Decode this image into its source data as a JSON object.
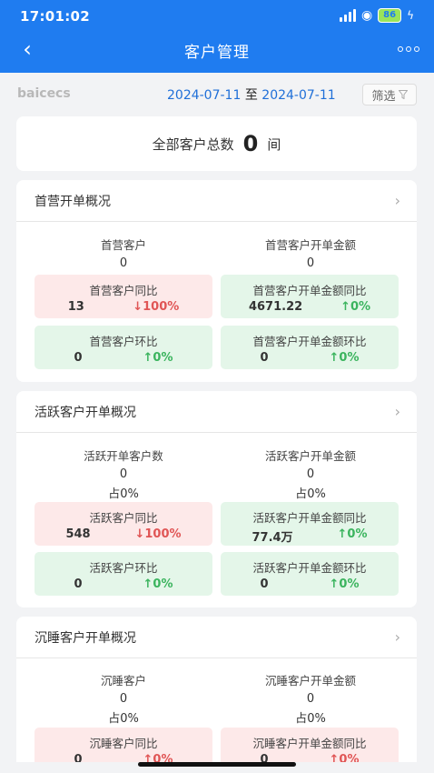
{
  "status_bar": {
    "time": "17:01:02",
    "battery": "86"
  },
  "nav": {
    "title": "客户管理"
  },
  "filter": {
    "brand": "baicecs",
    "start_date": "2024-07-11",
    "separator": "至",
    "end_date": "2024-07-11",
    "filter_label": "筛选"
  },
  "summary": {
    "label": "全部客户总数",
    "count": "0",
    "unit": "间"
  },
  "sections": [
    {
      "title": "首营开单概况",
      "left": {
        "label": "首营客户",
        "value": "0"
      },
      "right": {
        "label": "首营客户开单金额",
        "value": "0"
      },
      "boxes": [
        {
          "label": "首营客户同比",
          "value": "13",
          "change": "↓100%",
          "trend": "down"
        },
        {
          "label": "首营客户开单金额同比",
          "value": "4671.22",
          "change": "↑0%",
          "trend": "up"
        },
        {
          "label": "首营客户环比",
          "value": "0",
          "change": "↑0%",
          "trend": "up"
        },
        {
          "label": "首营客户开单金额环比",
          "value": "0",
          "change": "↑0%",
          "trend": "up"
        }
      ]
    },
    {
      "title": "活跃客户开单概况",
      "left": {
        "label": "活跃开单客户数",
        "value": "0",
        "pct": "占0%"
      },
      "right": {
        "label": "活跃客户开单金额",
        "value": "0",
        "pct": "占0%"
      },
      "boxes": [
        {
          "label": "活跃客户同比",
          "value": "548",
          "change": "↓100%",
          "trend": "down"
        },
        {
          "label": "活跃客户开单金额同比",
          "value": "77.4万",
          "change": "↑0%",
          "trend": "up"
        },
        {
          "label": "活跃客户环比",
          "value": "0",
          "change": "↑0%",
          "trend": "up"
        },
        {
          "label": "活跃客户开单金额环比",
          "value": "0",
          "change": "↑0%",
          "trend": "up"
        }
      ]
    },
    {
      "title": "沉睡客户开单概况",
      "left": {
        "label": "沉睡客户",
        "value": "0",
        "pct": "占0%"
      },
      "right": {
        "label": "沉睡客户开单金额",
        "value": "0",
        "pct": "占0%"
      },
      "boxes": [
        {
          "label": "沉睡客户同比",
          "value": "0",
          "change": "↑0%",
          "trend": "up"
        },
        {
          "label": "沉睡客户开单金额同比",
          "value": "0",
          "change": "↑0%",
          "trend": "up"
        }
      ]
    }
  ],
  "icons": {
    "back": "back-arrow-icon",
    "more": "more-options-icon",
    "filter": "funnel-icon",
    "chevron": "chevron-right-icon"
  },
  "colors": {
    "primary": "#1f7cf0",
    "up": "#3bb45e",
    "down": "#e05555",
    "up_bg": "#e4f6e9",
    "down_bg": "#fde9e9"
  }
}
